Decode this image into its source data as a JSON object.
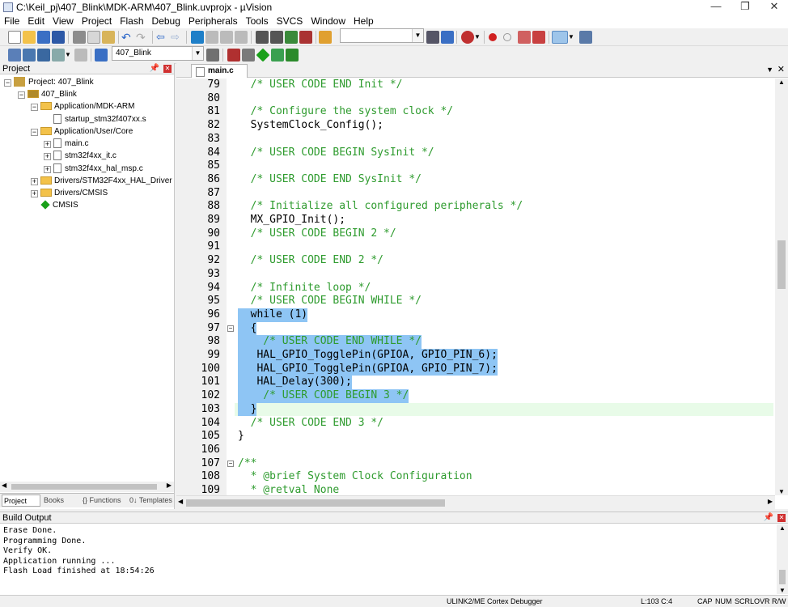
{
  "window": {
    "title": "C:\\Keil_pj\\407_Blink\\MDK-ARM\\407_Blink.uvprojx - µVision",
    "minimize": "—",
    "maximize": "❐",
    "close": "✕"
  },
  "menu": [
    "File",
    "Edit",
    "View",
    "Project",
    "Flash",
    "Debug",
    "Peripherals",
    "Tools",
    "SVCS",
    "Window",
    "Help"
  ],
  "toolbar2": {
    "target_value": "407_Blink"
  },
  "project_panel": {
    "header": "Project",
    "tree": [
      {
        "label": "Project: 407_Blink",
        "depth": 0
      },
      {
        "label": "407_Blink",
        "depth": 1
      },
      {
        "label": "Application/MDK-ARM",
        "depth": 2
      },
      {
        "label": "startup_stm32f407xx.s",
        "depth": 3
      },
      {
        "label": "Application/User/Core",
        "depth": 2
      },
      {
        "label": "main.c",
        "depth": 3
      },
      {
        "label": "stm32f4xx_it.c",
        "depth": 3
      },
      {
        "label": "stm32f4xx_hal_msp.c",
        "depth": 3
      },
      {
        "label": "Drivers/STM32F4xx_HAL_Driver",
        "depth": 2
      },
      {
        "label": "Drivers/CMSIS",
        "depth": 2
      },
      {
        "label": "CMSIS",
        "depth": 2
      }
    ],
    "tabs": [
      "Project",
      "Books",
      "{} Functions",
      "0↓ Templates"
    ]
  },
  "editor": {
    "tab_label": "main.c",
    "lines": [
      {
        "n": "79",
        "t": "  /* USER CODE END Init */",
        "k": "com"
      },
      {
        "n": "80",
        "t": "",
        "k": "code"
      },
      {
        "n": "81",
        "t": "  /* Configure the system clock */",
        "k": "com"
      },
      {
        "n": "82",
        "t": "  SystemClock_Config();",
        "k": "code"
      },
      {
        "n": "83",
        "t": "",
        "k": "code"
      },
      {
        "n": "84",
        "t": "  /* USER CODE BEGIN SysInit */",
        "k": "com"
      },
      {
        "n": "85",
        "t": "",
        "k": "code"
      },
      {
        "n": "86",
        "t": "  /* USER CODE END SysInit */",
        "k": "com"
      },
      {
        "n": "87",
        "t": "",
        "k": "code"
      },
      {
        "n": "88",
        "t": "  /* Initialize all configured peripherals */",
        "k": "com"
      },
      {
        "n": "89",
        "t": "  MX_GPIO_Init();",
        "k": "code"
      },
      {
        "n": "90",
        "t": "  /* USER CODE BEGIN 2 */",
        "k": "com"
      },
      {
        "n": "91",
        "t": "",
        "k": "code"
      },
      {
        "n": "92",
        "t": "  /* USER CODE END 2 */",
        "k": "com"
      },
      {
        "n": "93",
        "t": "",
        "k": "code"
      },
      {
        "n": "94",
        "t": "  /* Infinite loop */",
        "k": "com"
      },
      {
        "n": "95",
        "t": "  /* USER CODE BEGIN WHILE */",
        "k": "com"
      },
      {
        "n": "96",
        "t": "  while (1)",
        "k": "code"
      },
      {
        "n": "97",
        "t": "  {",
        "k": "code"
      },
      {
        "n": "98",
        "t": "    /* USER CODE END WHILE */",
        "k": "com"
      },
      {
        "n": "99",
        "t": "   HAL_GPIO_TogglePin(GPIOA, GPIO_PIN_6);",
        "k": "code"
      },
      {
        "n": "100",
        "t": "   HAL_GPIO_TogglePin(GPIOA, GPIO_PIN_7);",
        "k": "code"
      },
      {
        "n": "101",
        "t": "   HAL_Delay(300);",
        "k": "code"
      },
      {
        "n": "102",
        "t": "    /* USER CODE BEGIN 3 */",
        "k": "com"
      },
      {
        "n": "103",
        "t": "  }",
        "k": "code"
      },
      {
        "n": "104",
        "t": "  /* USER CODE END 3 */",
        "k": "com"
      },
      {
        "n": "105",
        "t": "}",
        "k": "code"
      },
      {
        "n": "106",
        "t": "",
        "k": "code"
      },
      {
        "n": "107",
        "t": "/**",
        "k": "com"
      },
      {
        "n": "108",
        "t": "  * @brief System Clock Configuration",
        "k": "com"
      },
      {
        "n": "109",
        "t": "  * @retval None",
        "k": "com"
      }
    ]
  },
  "build_output": {
    "header": "Build Output",
    "lines": [
      "Erase Done.",
      "Programming Done.",
      "Verify OK.",
      "Application running ...",
      "Flash Load finished at 18:54:26"
    ]
  },
  "status": {
    "debugger": "ULINK2/ME Cortex Debugger",
    "position": "L:103 C:4",
    "cap": "CAP",
    "num": "NUM",
    "scrl": "SCRL",
    "ovr": "OVR",
    "rw": "R/W"
  },
  "colors": {
    "selection": "#8ec5f4",
    "comment": "#2e9b2e",
    "current_line": "#e8fbe8"
  }
}
